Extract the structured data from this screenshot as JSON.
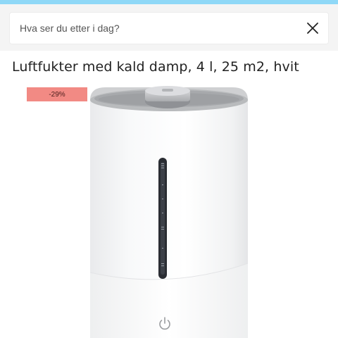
{
  "search": {
    "placeholder": "Hva ser du etter i dag?",
    "value": ""
  },
  "icons": {
    "close": "close-icon",
    "power": "power-icon"
  },
  "product": {
    "title": "Luftfukter med kald damp, 4 l, 25 m2, hvit",
    "discount_badge": "-29%"
  },
  "colors": {
    "top_band": "#8fd8f7",
    "discount_badge": "#f28a84"
  }
}
